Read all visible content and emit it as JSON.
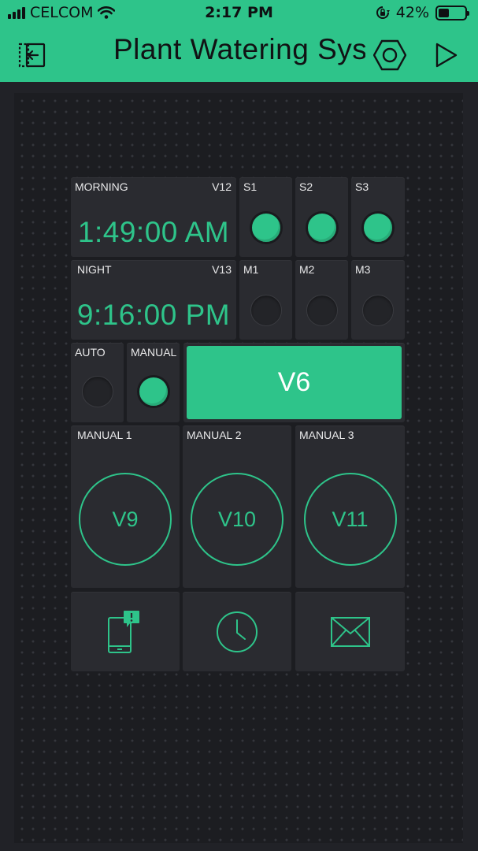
{
  "status_bar": {
    "carrier": "CELCOM",
    "time": "2:17 PM",
    "battery": "42%",
    "battery_level": 0.42
  },
  "header": {
    "title": "Plant Watering  Syst",
    "icons": [
      "exit-icon",
      "settings-hexagon-icon",
      "play-icon"
    ]
  },
  "colors": {
    "accent": "#2ec48a",
    "background": "#212227",
    "widget": "#2a2b30"
  },
  "timers": [
    {
      "label": "MORNING",
      "pin": "V12",
      "value": "1:49:00 AM"
    },
    {
      "label": "NIGHT",
      "pin": "V13",
      "value": "9:16:00 PM"
    }
  ],
  "leds_s": [
    {
      "label": "S1",
      "state": "on"
    },
    {
      "label": "S2",
      "state": "on"
    },
    {
      "label": "S3",
      "state": "on"
    }
  ],
  "leds_m": [
    {
      "label": "M1",
      "state": "off"
    },
    {
      "label": "M2",
      "state": "off"
    },
    {
      "label": "M3",
      "state": "off"
    }
  ],
  "mode": [
    {
      "label": "AUTO",
      "state": "off"
    },
    {
      "label": "MANUAL",
      "state": "on"
    }
  ],
  "button_v6": {
    "label": "V6"
  },
  "manual_buttons": [
    {
      "label": "MANUAL 1",
      "pin": "V9"
    },
    {
      "label": "MANUAL 2",
      "pin": "V10"
    },
    {
      "label": "MANUAL 3",
      "pin": "V11"
    }
  ],
  "bottom_icons": [
    "notification-phone-icon",
    "clock-icon",
    "email-icon"
  ]
}
